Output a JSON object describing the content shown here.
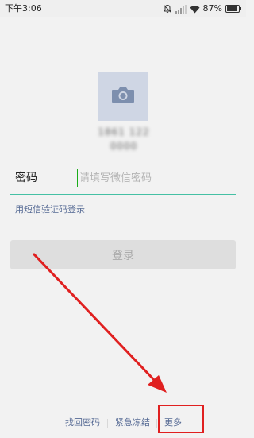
{
  "status_bar": {
    "time": "下午3:06",
    "battery": "87%",
    "icons": [
      "mute-icon",
      "signal-icon",
      "wifi-icon",
      "battery-icon"
    ]
  },
  "account": {
    "avatar_icon": "camera-icon",
    "name": "1861 122 0000"
  },
  "password": {
    "label": "密码",
    "placeholder": "请填写微信密码",
    "value": ""
  },
  "sms_login_link": "用短信验证码登录",
  "login_button": "登录",
  "bottom_links": {
    "recover": "找回密码",
    "freeze": "紧急冻结",
    "more": "更多"
  },
  "colors": {
    "accent_green": "#1aad19",
    "link_blue": "#576b95",
    "annotation_red": "#e02020"
  }
}
